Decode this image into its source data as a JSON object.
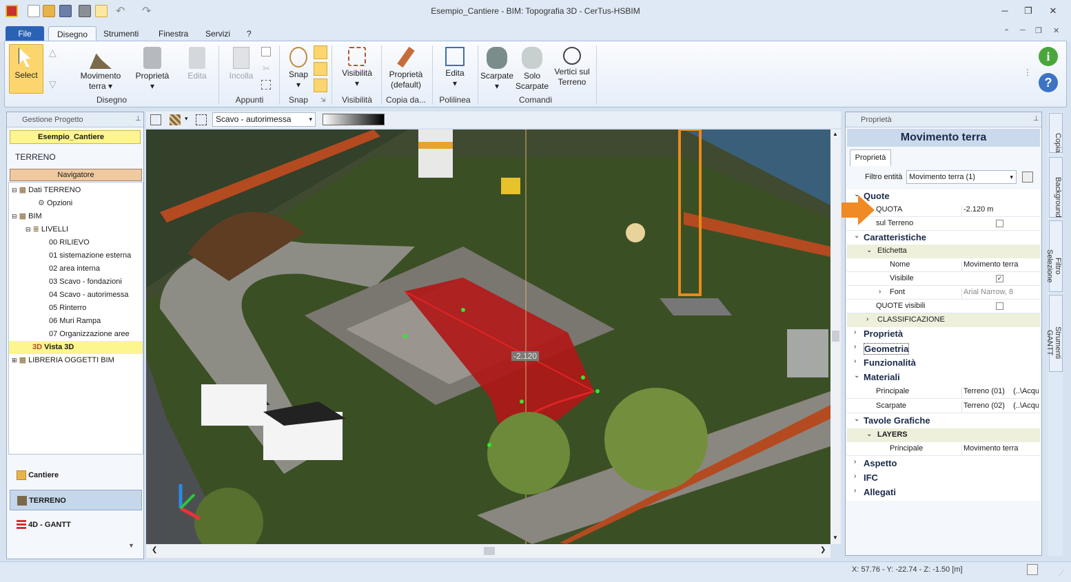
{
  "window": {
    "title": "Esempio_Cantiere -  BIM: Topografia 3D - CerTus-HSBIM"
  },
  "menu": {
    "tabs": [
      "File",
      "Disegno",
      "Strumenti",
      "Finestra",
      "Servizi",
      "?"
    ],
    "active": "Disegno"
  },
  "ribbon": {
    "select": "Select",
    "movimento_terra_1": "Movimento",
    "movimento_terra_2": "terra",
    "proprieta": "Proprietà",
    "edita_disabled": "Edita",
    "incolla": "Incolla",
    "snap": "Snap",
    "visibilita": "Visibilità",
    "proprieta_default_1": "Proprietà",
    "proprieta_default_2": "(default)",
    "edita": "Edita",
    "scarpate": "Scarpate",
    "solo_scarpate_1": "Solo",
    "solo_scarpate_2": "Scarpate",
    "vertici_1": "Vertici sul",
    "vertici_2": "Terreno",
    "groups": {
      "disegno": "Disegno",
      "appunti": "Appunti",
      "snap": "Snap",
      "visibilita": "Visibilità",
      "copia": "Copia da...",
      "polilinea": "Polilinea",
      "comandi": "Comandi"
    }
  },
  "left_panel": {
    "title": "Gestione Progetto",
    "project": "Esempio_Cantiere",
    "section": "TERRENO",
    "navigator": "Navigatore",
    "tree": {
      "dati_terreno": "Dati TERRENO",
      "opzioni": "Opzioni",
      "bim": "BIM",
      "livelli": "LIVELLI",
      "levels": [
        "00 RILIEVO",
        "01 sistemazione esterna",
        "02 area interna",
        "03 Scavo - fondazioni",
        "04 Scavo - autorimessa",
        "05 Rinterro",
        "06 Muri Rampa",
        "07 Organizzazione aree"
      ],
      "vista3d": "Vista 3D",
      "libreria": "LIBRERIA OGGETTI BIM"
    },
    "nav_buttons": [
      "Cantiere",
      "TERRENO",
      "4D - GANTT"
    ]
  },
  "viewport": {
    "layer_select": "Scavo - autorimessa",
    "height_label": "-2.120"
  },
  "properties": {
    "panel_title": "Proprietà",
    "object_title": "Movimento terra",
    "tab": "Proprietà",
    "filter_label": "Filtro entità",
    "filter_value": "Movimento terra (1)",
    "sections": {
      "quote": "Quote",
      "caratteristiche": "Caratteristiche",
      "proprieta": "Proprietà",
      "geometria": "Geometria",
      "funzionalita": "Funzionalità",
      "materiali": "Materiali",
      "tavole": "Tavole Grafiche",
      "aspetto": "Aspetto",
      "ifc": "IFC",
      "allegati": "Allegati"
    },
    "rows": {
      "quota_label": "QUOTA",
      "quota_value": "-2.120 m",
      "sul_terreno": "sul Terreno",
      "etichetta": "Etichetta",
      "nome_label": "Nome",
      "nome_value": "Movimento terra",
      "visibile": "Visibile",
      "font_label": "Font",
      "font_value": "Arial Narrow, 8",
      "quote_visibili": "QUOTE visibili",
      "classificazione": "CLASSIFICAZIONE",
      "principale_label": "Principale",
      "principale_value": "Terreno (01)    (..\\Acqu",
      "scarpate_label": "Scarpate",
      "scarpate_value": "Terreno (02)    (..\\Acqu",
      "layers": "LAYERS",
      "layers_principale": "Principale",
      "layers_principale_value": "Movimento terra"
    }
  },
  "sidebar_tabs": [
    "Copia",
    "Background",
    "Filtro Selezione",
    "Strumenti GANTT"
  ],
  "status": {
    "coords": "X: 57.76 - Y: -22.74 - Z: -1.50 [m]"
  }
}
